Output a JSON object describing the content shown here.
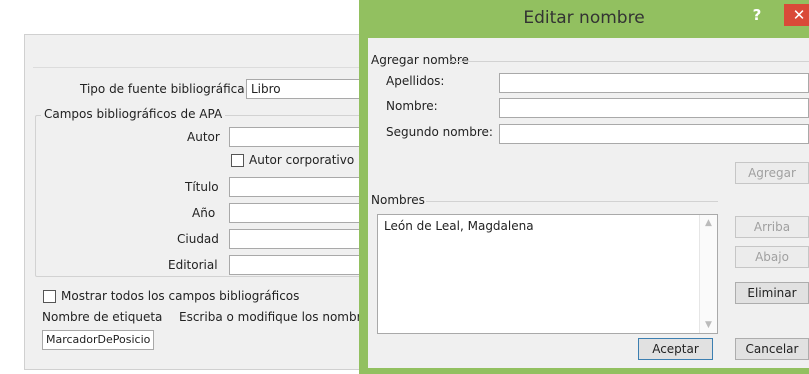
{
  "source_dialog": {
    "source_type_label": "Tipo de fuente bibliográfica",
    "source_type_value": "Libro",
    "group_label": "Campos bibliográficos de APA",
    "author_label": "Autor",
    "corporate_author_label": "Autor corporativo",
    "title_label": "Título",
    "year_label": "Año",
    "city_label": "Ciudad",
    "publisher_label": "Editorial",
    "show_all_label": "Mostrar todos los campos bibliográficos",
    "tag_name_label": "Nombre de etiqueta",
    "hint_text": "Escriba o modifique los nombres",
    "tag_value": "MarcadorDePosicio"
  },
  "edit_name_dialog": {
    "title": "Editar nombre",
    "help_glyph": "?",
    "close_glyph": "✕",
    "add_name_group": "Agregar nombre",
    "last_name_label": "Apellidos:",
    "first_name_label": "Nombre:",
    "middle_name_label": "Segundo nombre:",
    "add_button": "Agregar",
    "names_group": "Nombres",
    "names": [
      "León de Leal, Magdalena"
    ],
    "up_button": "Arriba",
    "down_button": "Abajo",
    "delete_button": "Eliminar",
    "ok_button": "Aceptar",
    "cancel_button": "Cancelar"
  },
  "colors": {
    "title_bar": "#92c060",
    "close_button": "#d94a38",
    "dialog_bg": "#f0f0f0"
  }
}
